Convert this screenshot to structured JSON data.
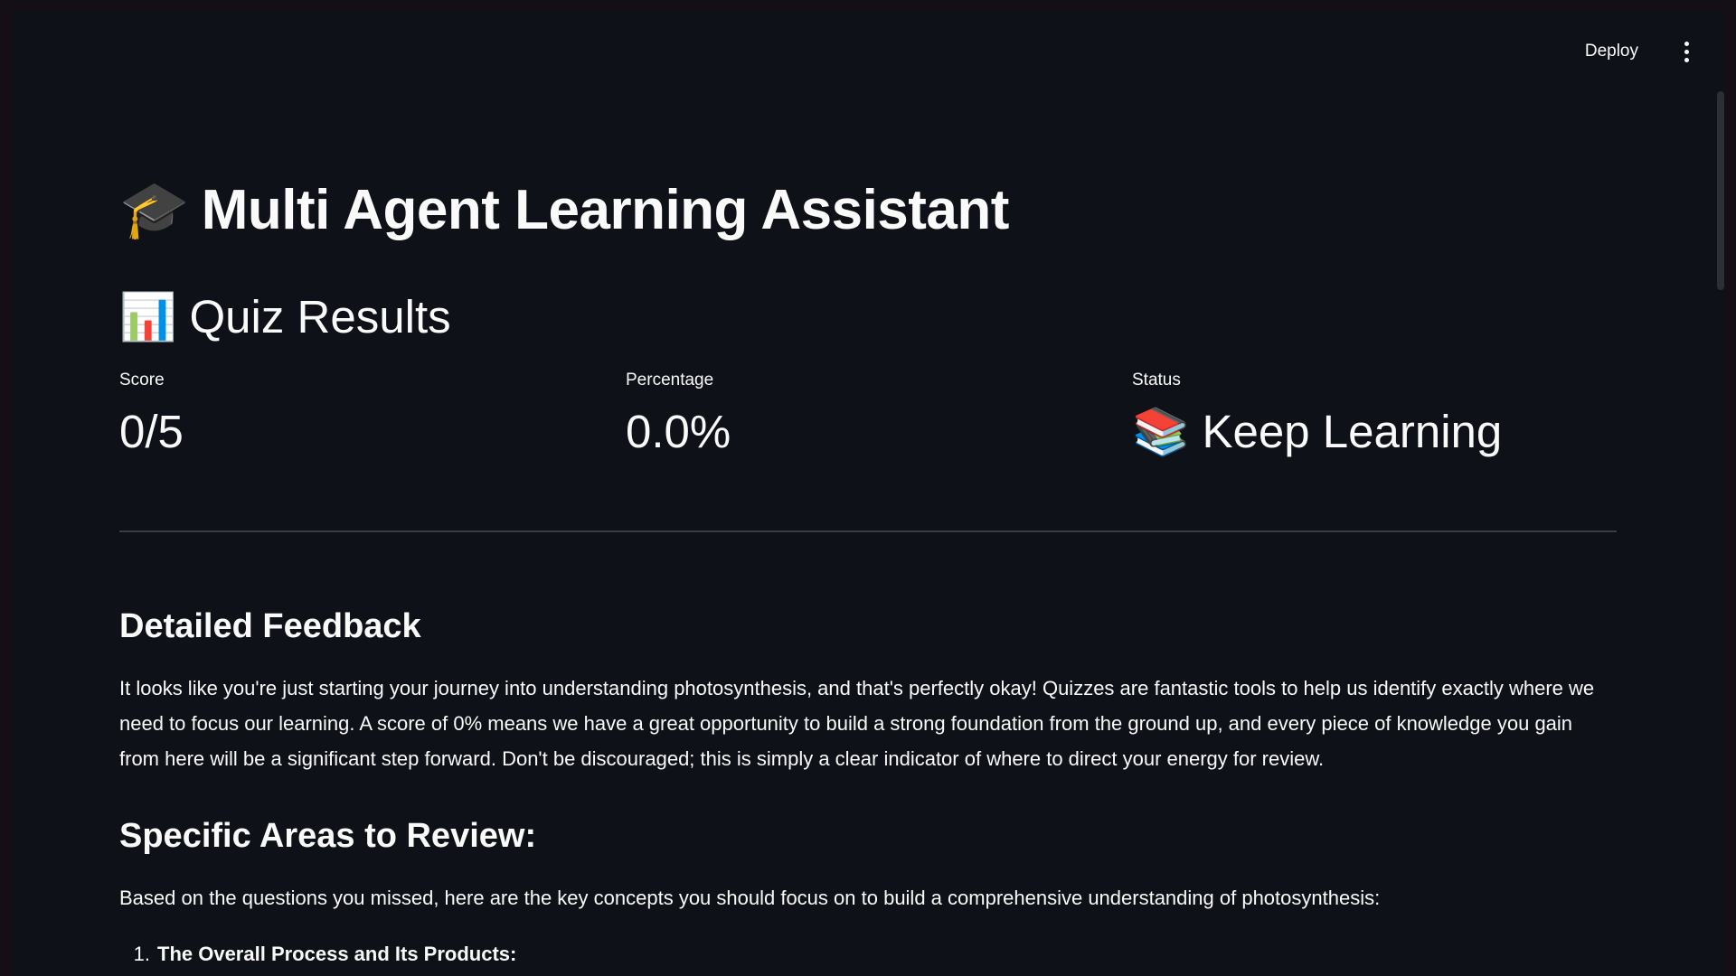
{
  "header": {
    "deploy_label": "Deploy",
    "menu_icon": "kebab-menu-icon"
  },
  "app": {
    "title_emoji": "🎓",
    "title": "Multi Agent Learning Assistant"
  },
  "results": {
    "section_emoji": "📊",
    "section_title": "Quiz Results",
    "metrics": [
      {
        "label": "Score",
        "value": "0/5"
      },
      {
        "label": "Percentage",
        "value": "0.0%"
      },
      {
        "label": "Status",
        "value_emoji": "📚",
        "value": "Keep Learning"
      }
    ]
  },
  "feedback": {
    "heading": "Detailed Feedback",
    "paragraph": "It looks like you're just starting your journey into understanding photosynthesis, and that's perfectly okay! Quizzes are fantastic tools to help us identify exactly where we need to focus our learning. A score of 0% means we have a great opportunity to build a strong foundation from the ground up, and every piece of knowledge you gain from here will be a significant step forward. Don't be discouraged; this is simply a clear indicator of where to direct your energy for review."
  },
  "review": {
    "heading": "Specific Areas to Review:",
    "intro": "Based on the questions you missed, here are the key concepts you should focus on to build a comprehensive understanding of photosynthesis:",
    "items": [
      {
        "number": "1.",
        "text": "The Overall Process and Its Products:"
      }
    ]
  },
  "colors": {
    "background": "#0e1117",
    "text": "#fafafa",
    "divider": "#3a3d45"
  }
}
